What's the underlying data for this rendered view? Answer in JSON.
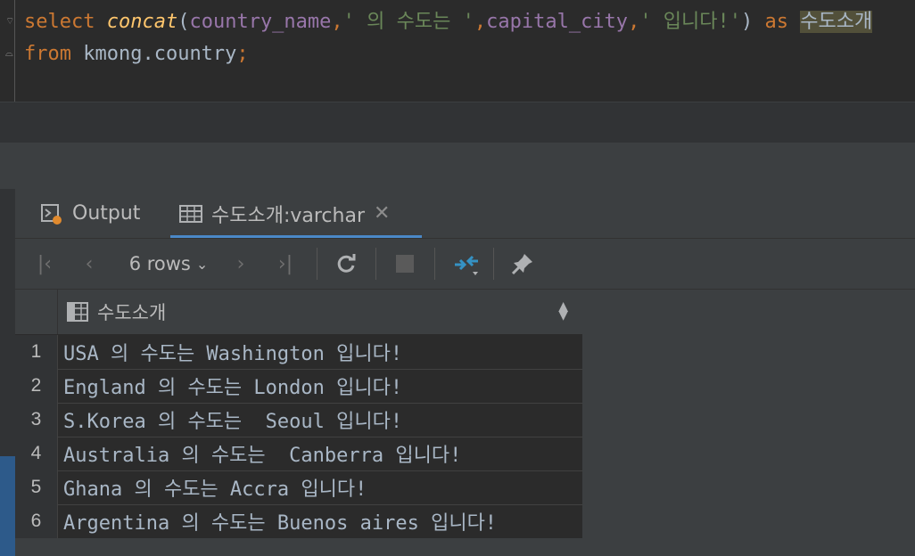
{
  "editor": {
    "line1": {
      "kw_select": "select",
      "fn_concat": "concat",
      "p_open": "(",
      "arg1": "country_name",
      "comma1": ",",
      "str1": "' 의 수도는 '",
      "comma2": ",",
      "arg2": "capital_city",
      "comma3": ",",
      "str2": "' 입니다!'",
      "p_close": ")",
      "kw_as": "as",
      "alias": "수도소개"
    },
    "line2": {
      "kw_from": "from",
      "table": "kmong.country",
      "semicolon": ";"
    }
  },
  "tabs": {
    "output": "Output",
    "result": "수도소개:varchar",
    "close": "✕"
  },
  "toolbar": {
    "first": "|‹",
    "prev": "‹",
    "rows": "6 rows",
    "dropdown": "⌄",
    "next": "›",
    "last": "›|"
  },
  "grid": {
    "column": "수도소개",
    "rows": [
      {
        "n": "1",
        "value": "USA 의 수도는 Washington 입니다!"
      },
      {
        "n": "2",
        "value": "England 의 수도는 London 입니다!"
      },
      {
        "n": "3",
        "value": "S.Korea 의 수도는  Seoul 입니다!"
      },
      {
        "n": "4",
        "value": "Australia 의 수도는  Canberra 입니다!"
      },
      {
        "n": "5",
        "value": "Ghana 의 수도는 Accra 입니다!"
      },
      {
        "n": "6",
        "value": "Argentina 의 수도는 Buenos aires 입니다!"
      }
    ]
  },
  "colors": {
    "keyword": "#cc7832",
    "function": "#ffc66d",
    "identifier": "#9876aa",
    "string": "#6a8759",
    "accent": "#4a88c7"
  }
}
